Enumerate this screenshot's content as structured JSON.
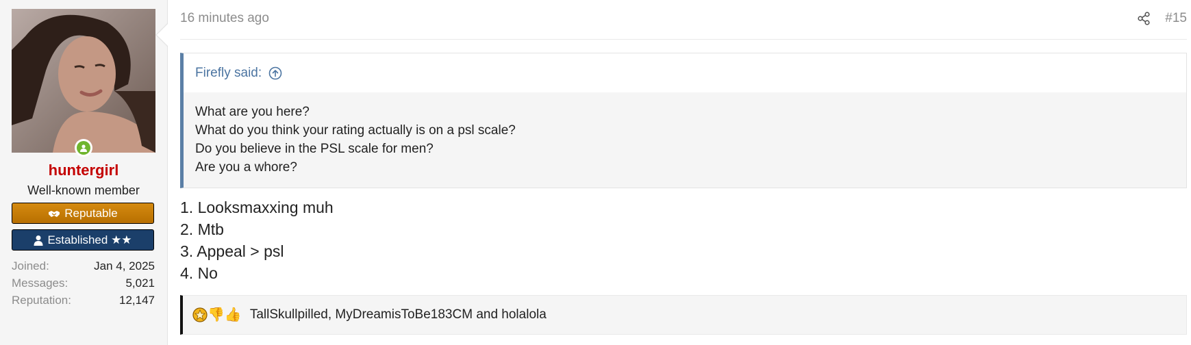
{
  "user": {
    "name": "huntergirl",
    "title": "Well-known member",
    "online": true,
    "banners": [
      {
        "label": "Reputable",
        "icon": "handshake-icon"
      },
      {
        "label": "Established ★★",
        "icon": "user-icon"
      }
    ],
    "stats": [
      {
        "label": "Joined:",
        "value": "Jan 4, 2025"
      },
      {
        "label": "Messages:",
        "value": "5,021"
      },
      {
        "label": "Reputation:",
        "value": "12,147"
      }
    ]
  },
  "post": {
    "timestamp": "16 minutes ago",
    "number": "#15",
    "quote": {
      "author": "Firefly said:",
      "lines": [
        "What are you here?",
        "What do you think your rating actually is on a psl scale?",
        "Do you believe in the PSL scale for men?",
        "Are you a whore?"
      ]
    },
    "answers": [
      "1. Looksmaxxing muh",
      "2. Mtb",
      "3. Appeal > psl",
      "4. No"
    ],
    "reactions": {
      "icons": [
        "star-badge-icon",
        "thumbs-down-icon",
        "thumbs-up-icon"
      ],
      "text": "TallSkullpilled, MyDreamisToBe183CM and holalola"
    }
  },
  "colors": {
    "username": "#c40000",
    "reputable_banner": "#c07600",
    "established_banner": "#1b3f6a",
    "quote_accent": "#5b7fa6",
    "online": "#6fb52e"
  }
}
